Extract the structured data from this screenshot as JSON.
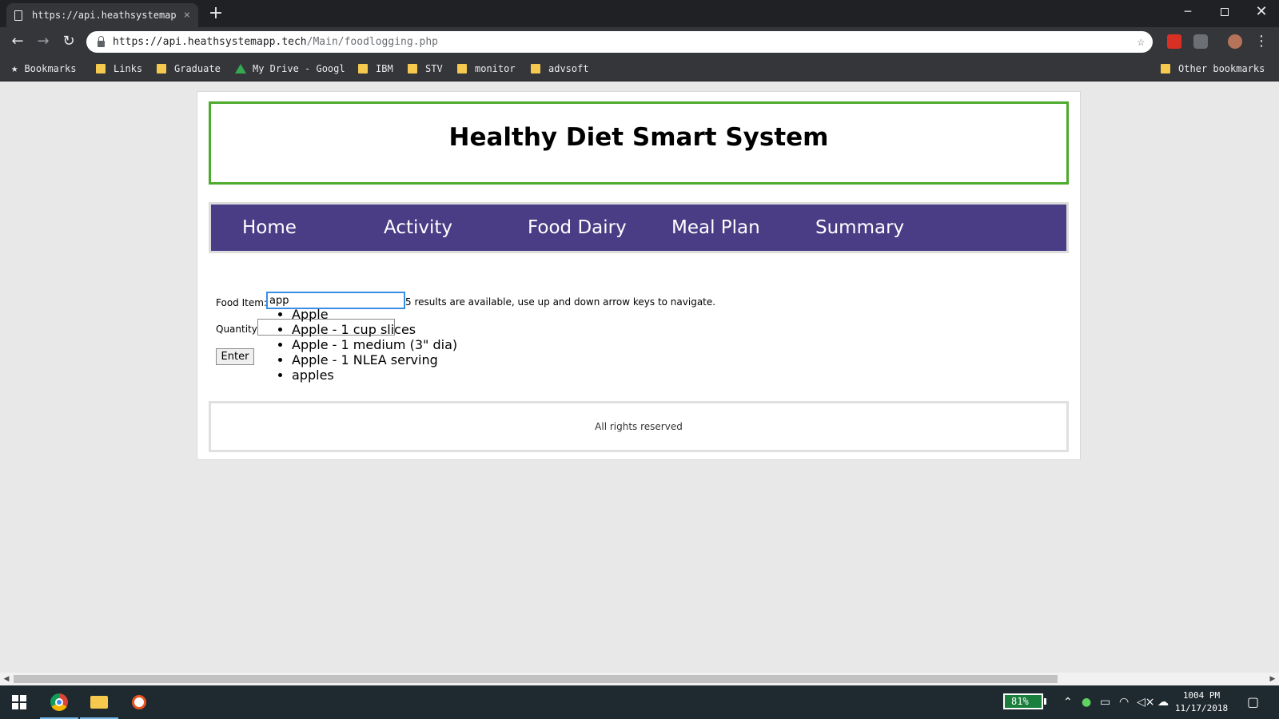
{
  "browser": {
    "tab_title": "https://api.heathsystemap",
    "tab_close": "×",
    "new_tab": "+",
    "url_host": "https://api.heathsystemapp.tech",
    "url_path": "/Main/foodlogging.php",
    "bookmarks": [
      "Bookmarks",
      "Links",
      "Graduate",
      "My Drive - Googl",
      "IBM",
      "STV",
      "monitor",
      "advsoft"
    ],
    "other_bookmarks": "Other bookmarks"
  },
  "page": {
    "title": "Healthy Diet Smart System",
    "nav": [
      "Home",
      "Activity",
      "Food Dairy",
      "Meal Plan",
      "Summary"
    ],
    "form": {
      "food_label": "Food Item:",
      "food_value": "app",
      "aria_status": "5 results are available, use up and down arrow keys to navigate.",
      "quantity_label": "Quantity",
      "quantity_value": "",
      "enter_label": "Enter",
      "suggestions": [
        "Apple",
        "Apple - 1 cup slices",
        "Apple - 1 medium (3\" dia)",
        "Apple - 1 NLEA serving",
        "apples"
      ]
    },
    "footer": "All rights reserved"
  },
  "taskbar": {
    "battery": "81%",
    "time": "1004 PM",
    "date": "11/17/2018"
  },
  "colors": {
    "header_border": "#4caa2d",
    "nav_background": "#4a3d86",
    "input_focus": "#3a8ee6"
  }
}
